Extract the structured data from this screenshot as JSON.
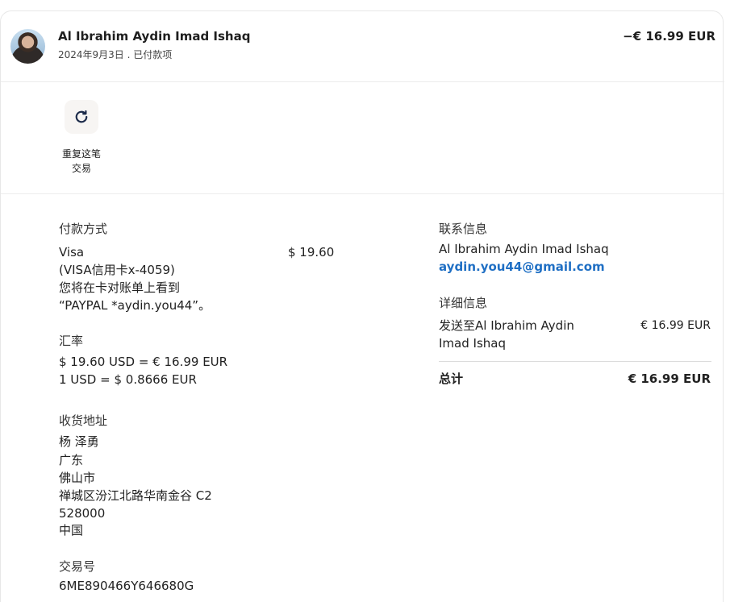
{
  "header": {
    "name": "Al Ibrahim Aydin Imad Ishaq",
    "date_status": "2024年9月3日 . 已付款项",
    "amount": "−€ 16.99 EUR"
  },
  "actions": {
    "repeat_label_line1": "重复这笔",
    "repeat_label_line2": "交易",
    "repeat_icon": "refresh-icon"
  },
  "payment": {
    "heading": "付款方式",
    "card_name": "Visa",
    "card_detail": "(VISA信用卡x-4059)",
    "statement_line1": "您将在卡对账单上看到",
    "statement_line2": "“PAYPAL *aydin.you44”。",
    "amount": "$ 19.60"
  },
  "exchange": {
    "heading": "汇率",
    "line1": "$ 19.60 USD = € 16.99 EUR",
    "line2": "1 USD = $ 0.8666 EUR"
  },
  "shipping": {
    "heading": "收货地址",
    "lines": [
      "杨 泽勇",
      "广东",
      "佛山市",
      "禅城区汾江北路华南金谷 C2",
      "528000",
      "中国"
    ]
  },
  "transaction": {
    "heading": "交易号",
    "id": "6ME890466Y646680G"
  },
  "contact": {
    "heading": "联系信息",
    "name": "Al Ibrahim Aydin Imad Ishaq",
    "email": "aydin.you44@gmail.com"
  },
  "details": {
    "heading": "详细信息",
    "item_line1": "发送至Al Ibrahim Aydin",
    "item_line2": "Imad Ishaq",
    "item_amount": "€ 16.99 EUR",
    "total_label": "总计",
    "total_amount": "€ 16.99 EUR"
  }
}
